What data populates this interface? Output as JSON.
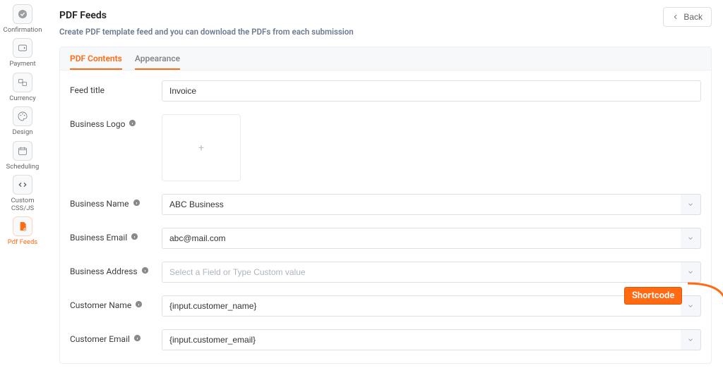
{
  "header": {
    "title": "PDF Feeds",
    "subtitle": "Create PDF template feed and you can download the PDFs from each submission",
    "back_label": "Back"
  },
  "tabs": {
    "contents": "PDF Contents",
    "appearance": "Appearance"
  },
  "sidebar": [
    {
      "label": "Confirmation",
      "icon": "check-circle-icon"
    },
    {
      "label": "Payment",
      "icon": "wallet-icon"
    },
    {
      "label": "Currency",
      "icon": "currency-icon"
    },
    {
      "label": "Design",
      "icon": "palette-icon"
    },
    {
      "label": "Scheduling",
      "icon": "calendar-icon"
    },
    {
      "label": "Custom CSS/JS",
      "icon": "code-icon"
    },
    {
      "label": "Pdf Feeds",
      "icon": "pdf-icon",
      "active": true
    }
  ],
  "form": {
    "feed_title": {
      "label": "Feed title",
      "value": "Invoice"
    },
    "business_logo": {
      "label": "Business Logo"
    },
    "business_name": {
      "label": "Business Name",
      "value": "ABC Business"
    },
    "business_email": {
      "label": "Business Email",
      "value": "abc@mail.com"
    },
    "business_address": {
      "label": "Business Address",
      "placeholder": "Select a Field or Type Custom value"
    },
    "customer_name": {
      "label": "Customer Name",
      "value": "{input.customer_name}"
    },
    "customer_email": {
      "label": "Customer Email",
      "value": "{input.customer_email}"
    }
  },
  "annotation": {
    "callout": "Shortcode"
  }
}
